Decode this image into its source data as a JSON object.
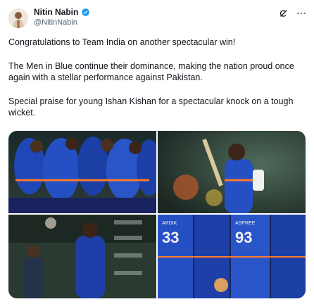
{
  "post": {
    "author_name": "Nitin Nabin",
    "author_handle": "@NitinNabin",
    "paragraphs": [
      "Congratulations to Team India on another spectacular win!",
      "The Men in Blue continue their dominance, making the nation proud once again with a stellar performance against Pakistan.",
      "Special praise for young Ishan Kishan for a spectacular knock on a tough wicket."
    ]
  },
  "icons": {
    "verified": "verified-badge-icon",
    "grok": "grok-icon",
    "more": "more-options-icon"
  },
  "media": {
    "photo_labels": [
      "33",
      "93",
      "ARDIK",
      "ASPREE"
    ]
  },
  "colors": {
    "verified_blue": "#1d9bf0",
    "handle_gray": "#536471",
    "jersey_blue": "#1e3fa8"
  }
}
